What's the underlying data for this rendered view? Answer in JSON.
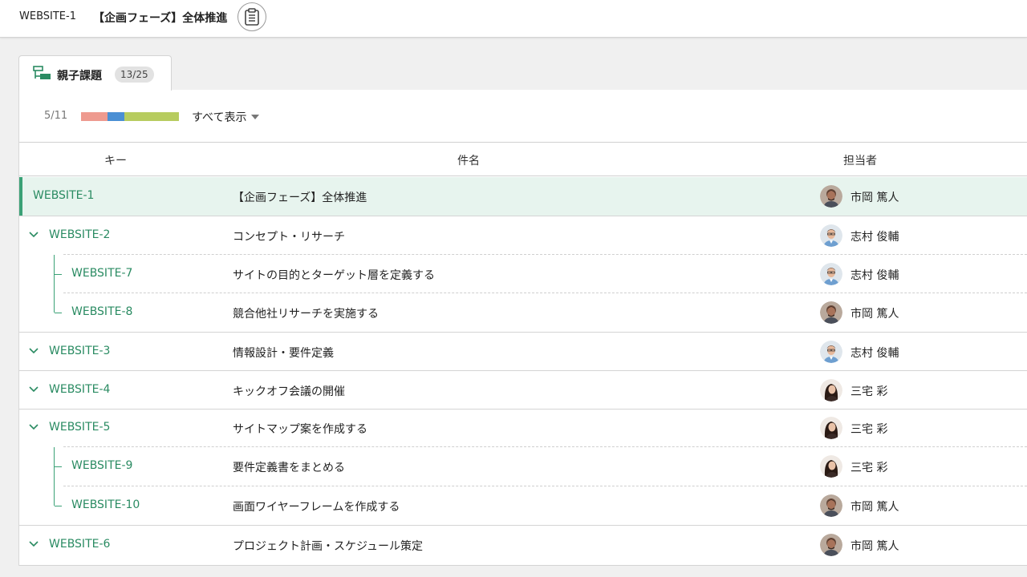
{
  "header": {
    "issue_key": "WEBSITE-1",
    "issue_title": "【企画フェーズ】全体推進",
    "clipboard_icon": "clipboard-icon"
  },
  "tab": {
    "icon": "parent-child-icon",
    "label": "親子課題",
    "count": "13/25"
  },
  "progress": {
    "text": "5/11",
    "segments": [
      {
        "status": "open",
        "color": "#ee9a8f",
        "fraction": 0.27
      },
      {
        "status": "in-progress",
        "color": "#4a8fd4",
        "fraction": 0.17
      },
      {
        "status": "resolved",
        "color": "#b7cc5f",
        "fraction": 0.56
      }
    ]
  },
  "filter": {
    "label": "すべて表示"
  },
  "table": {
    "columns": {
      "key": "キー",
      "summary": "件名",
      "assignee": "担当者"
    },
    "rows": [
      {
        "key": "WEBSITE-1",
        "summary": "【企画フェーズ】全体推進",
        "assignee": "市岡 篤人",
        "avatar": "ichioka"
      },
      {
        "key": "WEBSITE-2",
        "summary": "コンセプト・リサーチ",
        "assignee": "志村 俊輔",
        "avatar": "shimura"
      },
      {
        "key": "WEBSITE-7",
        "summary": "サイトの目的とターゲット層を定義する",
        "assignee": "志村 俊輔",
        "avatar": "shimura"
      },
      {
        "key": "WEBSITE-8",
        "summary": "競合他社リサーチを実施する",
        "assignee": "市岡 篤人",
        "avatar": "ichioka"
      },
      {
        "key": "WEBSITE-3",
        "summary": "情報設計・要件定義",
        "assignee": "志村 俊輔",
        "avatar": "shimura"
      },
      {
        "key": "WEBSITE-4",
        "summary": "キックオフ会議の開催",
        "assignee": "三宅 彩",
        "avatar": "miyake"
      },
      {
        "key": "WEBSITE-5",
        "summary": "サイトマップ案を作成する",
        "assignee": "三宅 彩",
        "avatar": "miyake"
      },
      {
        "key": "WEBSITE-9",
        "summary": "要件定義書をまとめる",
        "assignee": "三宅 彩",
        "avatar": "miyake"
      },
      {
        "key": "WEBSITE-10",
        "summary": "画面ワイヤーフレームを作成する",
        "assignee": "市岡 篤人",
        "avatar": "ichioka"
      },
      {
        "key": "WEBSITE-6",
        "summary": "プロジェクト計画・スケジュール策定",
        "assignee": "市岡 篤人",
        "avatar": "ichioka"
      }
    ]
  },
  "colors": {
    "accent": "#3aa176",
    "link": "#2a8b62",
    "selected_row": "#e7f4ee"
  }
}
